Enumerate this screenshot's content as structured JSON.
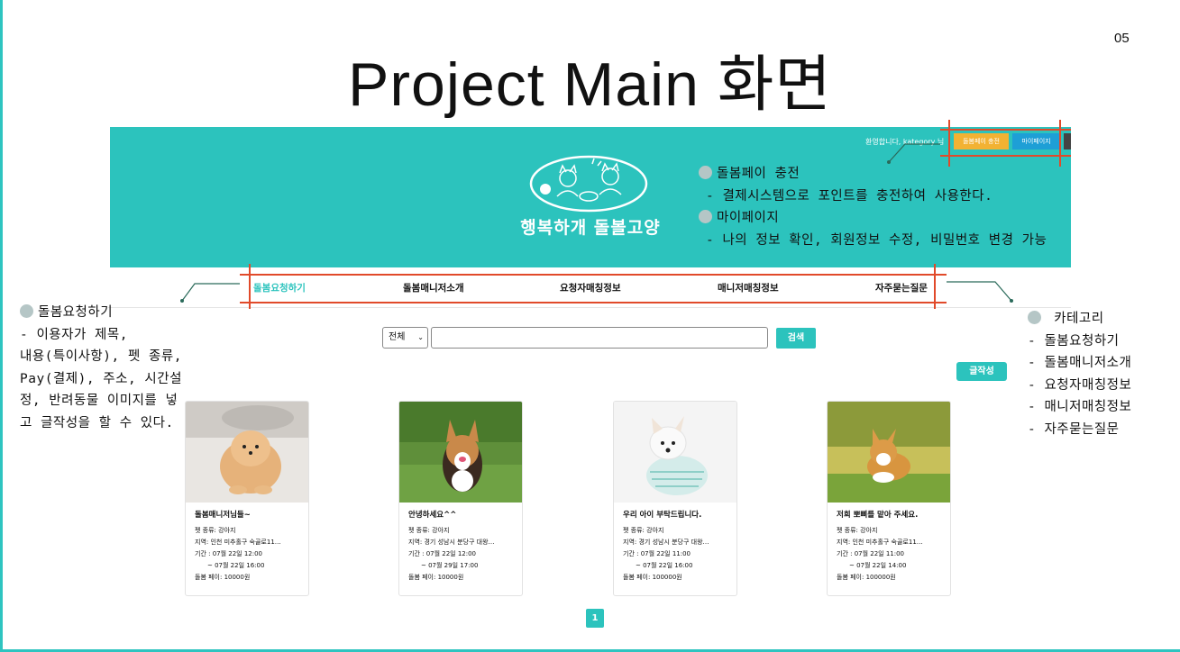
{
  "slide": {
    "title": "Project Main 화면",
    "page_number": "05"
  },
  "header": {
    "welcome_text": "환영합니다, kategory 님",
    "charge_button": "돌봄페이 충전",
    "mypage_button": "마이페이지",
    "logo_text": "행복하개 돌볼고양"
  },
  "nav": {
    "items": [
      {
        "label": "돌봄요청하기"
      },
      {
        "label": "돌봄매니저소개"
      },
      {
        "label": "요청자매칭정보"
      },
      {
        "label": "매니저매칭정보"
      },
      {
        "label": "자주묻는질문"
      }
    ]
  },
  "search": {
    "select_value": "전체",
    "input_value": "",
    "button_label": "검색"
  },
  "write_button": "글작성",
  "cards": [
    {
      "title": "돌봄매니저님들~",
      "pet": "펫 종류: 강아지",
      "region": "지역: 인천 미추홀구 숙골로11…",
      "period_start": "기간 : 07월 22일 12:00",
      "period_end": "~ 07월 22일 16:00",
      "pay": "돌봄 페이: 10000원"
    },
    {
      "title": "안녕하세요^^",
      "pet": "펫 종류: 강아지",
      "region": "지역: 경기 성남시 분당구 대왕…",
      "period_start": "기간 : 07월 22일 12:00",
      "period_end": "~ 07월 29일 17:00",
      "pay": "돌봄 페이: 10000원"
    },
    {
      "title": "우리 아이 부탁드립니다.",
      "pet": "펫 종류: 강아지",
      "region": "지역: 경기 성남시 분당구 대왕…",
      "period_start": "기간 : 07월 22일 11:00",
      "period_end": "~ 07월 22일 16:00",
      "pay": "돌봄 페이: 100000원"
    },
    {
      "title": "저희 뽀삐를 맡아 주세요.",
      "pet": "펫 종류: 강아지",
      "region": "지역: 인천 미추홀구 숙골로11…",
      "period_start": "기간 : 07월 22일 11:00",
      "period_end": "~ 07월 22일 14:00",
      "pay": "돌봄 페이: 100000원"
    }
  ],
  "pagination": {
    "current": "1"
  },
  "callouts": {
    "top": {
      "heading1": "돌봄페이 충전",
      "desc1": "- 결제시스템으로 포인트를 충전하여 사용한다.",
      "heading2": "마이페이지",
      "desc2": "- 나의 정보 확인, 회원정보 수정, 비밀번호 변경 가능"
    },
    "left": {
      "heading": "돌봄요청하기",
      "lines": [
        "- 이용자가 제목,",
        "내용(특이사항), 펫 종류,",
        "Pay(결제), 주소, 시간설",
        "정, 반려동물 이미지를 넣",
        "고 글작성을 할 수 있다."
      ]
    },
    "right": {
      "heading": "카테고리",
      "lines": [
        "- 돌봄요청하기",
        "- 돌봄매니저소개",
        "- 요청자매칭정보",
        "- 매니저매칭정보",
        "- 자주묻는질문"
      ]
    }
  },
  "colors": {
    "accent": "#2cc3bd",
    "charge": "#f2b233",
    "mypage": "#1e9fd6",
    "annotation_red": "#e14a2a"
  }
}
